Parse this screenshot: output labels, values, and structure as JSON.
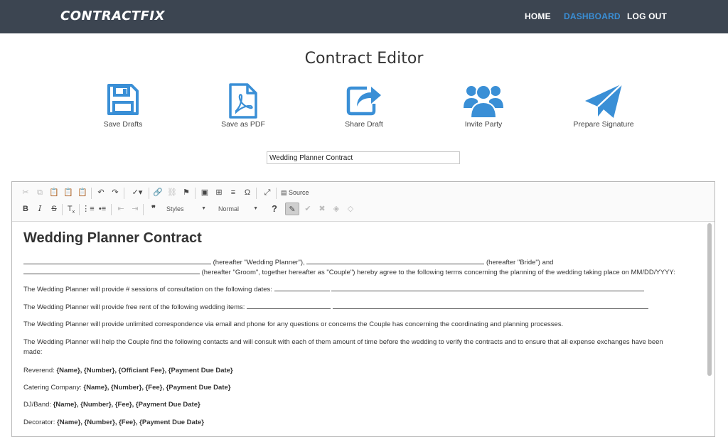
{
  "nav": {
    "brand": "CONTRACTFIX",
    "home": "HOME",
    "dashboard": "DASHBOARD",
    "logout": "LOG OUT",
    "active_color": "#3a8fd6"
  },
  "page": {
    "title": "Contract Editor"
  },
  "actions": [
    {
      "label": "Save Drafts",
      "icon": "floppy-disk-icon"
    },
    {
      "label": "Save as PDF",
      "icon": "pdf-file-icon"
    },
    {
      "label": "Share Draft",
      "icon": "share-icon"
    },
    {
      "label": "Invite Party",
      "icon": "users-group-icon"
    },
    {
      "label": "Prepare Signature",
      "icon": "paper-plane-icon"
    }
  ],
  "title_field": {
    "value": "Wedding Planner Contract"
  },
  "toolbar": {
    "source_label": "Source",
    "styles_label": "Styles",
    "format_label": "Normal",
    "help_label": "?"
  },
  "document": {
    "heading": "Wedding Planner Contract",
    "p1a": "(hereafter \"Wedding Planner\"),",
    "p1b": "(hereafter \"Bride\") and",
    "p1c": "(hereafter \"Groom\", together hereafter as \"Couple\") hereby agree to the following terms concerning the planning of the wedding taking place on MM/DD/YYYY:",
    "p2": "The Wedding Planner will provide # sessions of consultation on the following dates:",
    "p3": "The Wedding Planner will provide free rent of the following wedding items:",
    "p4": "The Wedding Planner will provide unlimited correspondence via email and phone for any questions or concerns the Couple has concerning the coordinating and planning processes.",
    "p5a": "The Wedding Planner will help the Couple find the following contacts and will consult with each of them amount of time before the wedding to verify the contracts and to ensure that all expense exchanges have been",
    "p5b": "made:",
    "reverend_label": "Reverend:",
    "reverend_fields": "{Name}, {Number}, {Officiant Fee}, {Payment Due Date}",
    "catering_label": "Catering Company:",
    "catering_fields": "{Name}, {Number}, {Fee}, {Payment Due Date}",
    "dj_label": "DJ/Band:",
    "dj_fields": "{Name}, {Number}, {Fee}, {Payment Due Date}",
    "decorator_label": "Decorator:",
    "decorator_fields": "{Name}, {Number}, {Fee}, {Payment Due Date}"
  }
}
